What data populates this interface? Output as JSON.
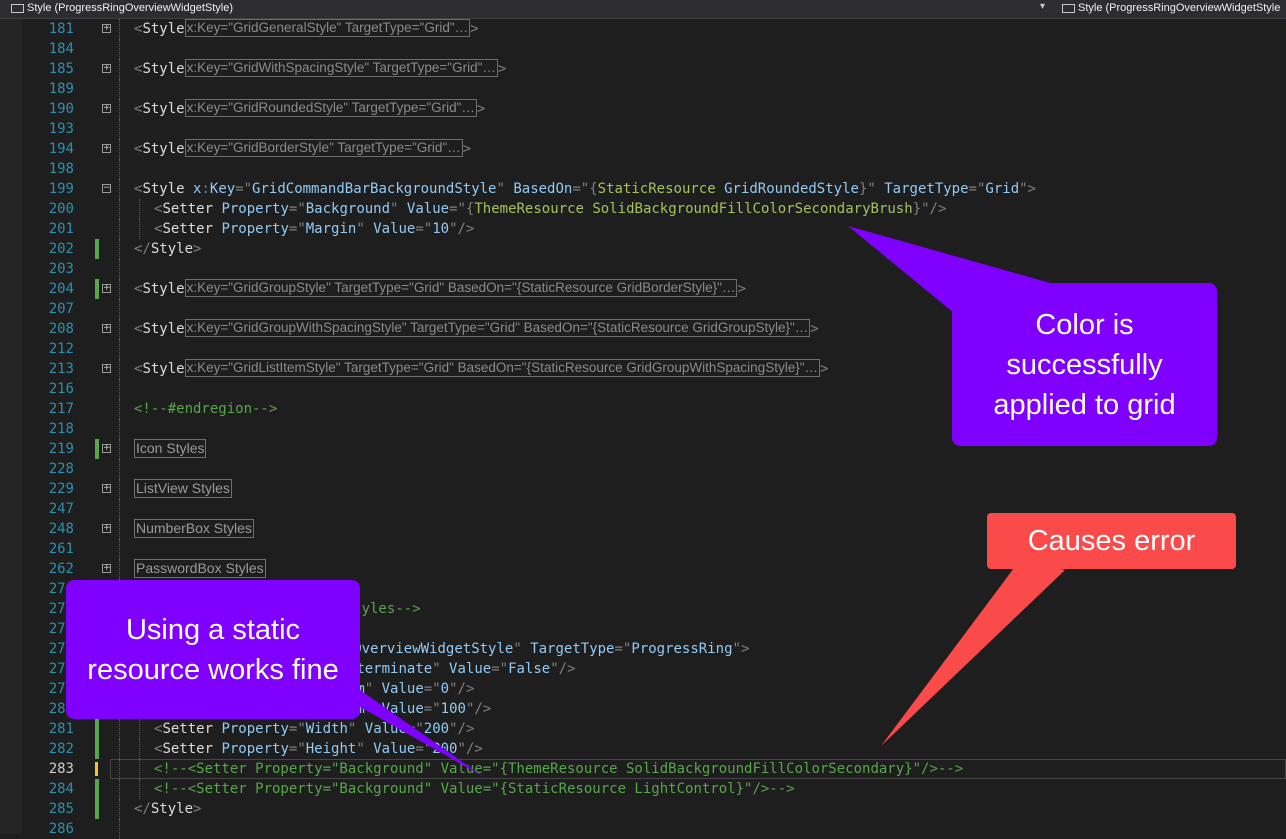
{
  "toolbar": {
    "left_label": "Style (ProgressRingOverviewWidgetStyle)",
    "right_label": "Style (ProgressRingOverviewWidgetStyle"
  },
  "lines": [
    {
      "n": "181",
      "tokens": [
        [
          "<",
          "p"
        ],
        [
          "Style",
          "e"
        ]
      ],
      "collapsed": "x:Key=\"GridGeneralStyle\" TargetType=\"Grid\"…",
      "after": ">",
      "fold": true
    },
    {
      "n": "184",
      "tokens": []
    },
    {
      "n": "185",
      "tokens": [
        [
          "<",
          "p"
        ],
        [
          "Style",
          "e"
        ]
      ],
      "collapsed": "x:Key=\"GridWithSpacingStyle\" TargetType=\"Grid\"…",
      "after": ">",
      "fold": true
    },
    {
      "n": "189",
      "tokens": []
    },
    {
      "n": "190",
      "tokens": [
        [
          "<",
          "p"
        ],
        [
          "Style",
          "e"
        ]
      ],
      "collapsed": "x:Key=\"GridRoundedStyle\" TargetType=\"Grid\"…",
      "after": ">",
      "fold": true
    },
    {
      "n": "193",
      "tokens": []
    },
    {
      "n": "194",
      "tokens": [
        [
          "<",
          "p"
        ],
        [
          "Style",
          "e"
        ]
      ],
      "collapsed": "x:Key=\"GridBorderStyle\" TargetType=\"Grid\"…",
      "after": ">",
      "fold": true
    },
    {
      "n": "198",
      "tokens": []
    },
    {
      "n": "199",
      "tokens": [
        [
          "<",
          "p"
        ],
        [
          "Style ",
          "e"
        ],
        [
          "x",
          "a"
        ],
        [
          ":",
          "p"
        ],
        [
          "Key",
          "a"
        ],
        [
          "=\"",
          "p"
        ],
        [
          "GridCommandBarBackgroundStyle",
          "a"
        ],
        [
          "\" ",
          "p"
        ],
        [
          "BasedOn",
          "a"
        ],
        [
          "=\"{",
          "p"
        ],
        [
          "StaticResource ",
          "v"
        ],
        [
          "GridRoundedStyle",
          "a"
        ],
        [
          "}\" ",
          "p"
        ],
        [
          "TargetType",
          "a"
        ],
        [
          "=\"",
          "p"
        ],
        [
          "Grid",
          "a"
        ],
        [
          "\">",
          "p"
        ]
      ],
      "fold": "minus"
    },
    {
      "n": "200",
      "indent": 1,
      "tokens": [
        [
          "<",
          "p"
        ],
        [
          "Setter ",
          "e"
        ],
        [
          "Property",
          "a"
        ],
        [
          "=\"",
          "p"
        ],
        [
          "Background",
          "a"
        ],
        [
          "\" ",
          "p"
        ],
        [
          "Value",
          "a"
        ],
        [
          "=\"{",
          "p"
        ],
        [
          "ThemeResource ",
          "v"
        ],
        [
          "SolidBackgroundFillColorSecondaryBrush",
          "v"
        ],
        [
          "}\"",
          "p"
        ],
        [
          "/>",
          "p"
        ]
      ]
    },
    {
      "n": "201",
      "indent": 1,
      "tokens": [
        [
          "<",
          "p"
        ],
        [
          "Setter ",
          "e"
        ],
        [
          "Property",
          "a"
        ],
        [
          "=\"",
          "p"
        ],
        [
          "Margin",
          "a"
        ],
        [
          "\" ",
          "p"
        ],
        [
          "Value",
          "a"
        ],
        [
          "=\"",
          "p"
        ],
        [
          "10",
          "a"
        ],
        [
          "\"",
          "p"
        ],
        [
          "/>",
          "p"
        ]
      ]
    },
    {
      "n": "202",
      "tokens": [
        [
          "</",
          "p"
        ],
        [
          "Style",
          "e"
        ],
        [
          ">",
          "p"
        ]
      ],
      "chg": true
    },
    {
      "n": "203",
      "tokens": []
    },
    {
      "n": "204",
      "tokens": [
        [
          "<",
          "p"
        ],
        [
          "Style",
          "e"
        ]
      ],
      "collapsed": "x:Key=\"GridGroupStyle\" TargetType=\"Grid\" BasedOn=\"{StaticResource GridBorderStyle}\"…",
      "after": ">",
      "fold": true,
      "chg": true
    },
    {
      "n": "207",
      "tokens": []
    },
    {
      "n": "208",
      "tokens": [
        [
          "<",
          "p"
        ],
        [
          "Style",
          "e"
        ]
      ],
      "collapsed": "x:Key=\"GridGroupWithSpacingStyle\" TargetType=\"Grid\" BasedOn=\"{StaticResource GridGroupStyle}\"…",
      "after": ">",
      "fold": true
    },
    {
      "n": "212",
      "tokens": []
    },
    {
      "n": "213",
      "tokens": [
        [
          "<",
          "p"
        ],
        [
          "Style",
          "e"
        ]
      ],
      "collapsed": "x:Key=\"GridListItemStyle\" TargetType=\"Grid\" BasedOn=\"{StaticResource GridGroupWithSpacingStyle}\"…",
      "after": ">",
      "fold": true
    },
    {
      "n": "216",
      "tokens": []
    },
    {
      "n": "217",
      "tokens": [
        [
          "<!--#endregion-->",
          "c"
        ]
      ]
    },
    {
      "n": "218",
      "tokens": []
    },
    {
      "n": "219",
      "region": "Icon Styles",
      "fold": true,
      "chg": true
    },
    {
      "n": "228",
      "tokens": []
    },
    {
      "n": "229",
      "region": "ListView Styles",
      "fold": true
    },
    {
      "n": "247",
      "tokens": []
    },
    {
      "n": "248",
      "region": "NumberBox Styles",
      "fold": true
    },
    {
      "n": "261",
      "tokens": []
    },
    {
      "n": "262",
      "region": "PasswordBox Styles",
      "fold": true
    },
    {
      "n": "274",
      "tokens": []
    },
    {
      "n": "275",
      "tokens": [
        [
          "<!--#region ProgressRing Styles-->",
          "c"
        ]
      ]
    },
    {
      "n": "276",
      "tokens": []
    },
    {
      "n": "277",
      "tokens": [
        [
          "<",
          "p"
        ],
        [
          "Style ",
          "e"
        ],
        [
          "x",
          "a"
        ],
        [
          ":",
          "p"
        ],
        [
          "Key",
          "a"
        ],
        [
          "=\"",
          "p"
        ],
        [
          "ProgressRingOverviewWidgetStyle",
          "a"
        ],
        [
          "\" ",
          "p"
        ],
        [
          "TargetType",
          "a"
        ],
        [
          "=\"",
          "p"
        ],
        [
          "ProgressRing",
          "a"
        ],
        [
          "\">",
          "p"
        ]
      ]
    },
    {
      "n": "278",
      "indent": 1,
      "tokens": [
        [
          "<",
          "p"
        ],
        [
          "Setter ",
          "e"
        ],
        [
          "Property",
          "a"
        ],
        [
          "=\"",
          "p"
        ],
        [
          "IsIndeterminate",
          "a"
        ],
        [
          "\" ",
          "p"
        ],
        [
          "Value",
          "a"
        ],
        [
          "=\"",
          "p"
        ],
        [
          "False",
          "a"
        ],
        [
          "\"",
          "p"
        ],
        [
          "/>",
          "p"
        ]
      ]
    },
    {
      "n": "279",
      "indent": 1,
      "tokens": [
        [
          "<",
          "p"
        ],
        [
          "Setter ",
          "e"
        ],
        [
          "Property",
          "a"
        ],
        [
          "=\"",
          "p"
        ],
        [
          "Minimum",
          "a"
        ],
        [
          "\" ",
          "p"
        ],
        [
          "Value",
          "a"
        ],
        [
          "=\"",
          "p"
        ],
        [
          "0",
          "a"
        ],
        [
          "\"",
          "p"
        ],
        [
          "/>",
          "p"
        ]
      ]
    },
    {
      "n": "280",
      "indent": 1,
      "tokens": [
        [
          "<",
          "p"
        ],
        [
          "Setter ",
          "e"
        ],
        [
          "Property",
          "a"
        ],
        [
          "=\"",
          "p"
        ],
        [
          "Maximum",
          "a"
        ],
        [
          "\" ",
          "p"
        ],
        [
          "Value",
          "a"
        ],
        [
          "=\"",
          "p"
        ],
        [
          "100",
          "a"
        ],
        [
          "\"",
          "p"
        ],
        [
          "/>",
          "p"
        ]
      ]
    },
    {
      "n": "281",
      "indent": 1,
      "tokens": [
        [
          "<",
          "p"
        ],
        [
          "Setter ",
          "e"
        ],
        [
          "Property",
          "a"
        ],
        [
          "=\"",
          "p"
        ],
        [
          "Width",
          "a"
        ],
        [
          "\" ",
          "p"
        ],
        [
          "Value",
          "a"
        ],
        [
          "=\"",
          "p"
        ],
        [
          "200",
          "a"
        ],
        [
          "\"",
          "p"
        ],
        [
          "/>",
          "p"
        ]
      ],
      "chg": true
    },
    {
      "n": "282",
      "indent": 1,
      "tokens": [
        [
          "<",
          "p"
        ],
        [
          "Setter ",
          "e"
        ],
        [
          "Property",
          "a"
        ],
        [
          "=\"",
          "p"
        ],
        [
          "Height",
          "a"
        ],
        [
          "\" ",
          "p"
        ],
        [
          "Value",
          "a"
        ],
        [
          "=\"",
          "p"
        ],
        [
          "200",
          "a"
        ],
        [
          "\"",
          "p"
        ],
        [
          "/>",
          "p"
        ]
      ],
      "chg": true
    },
    {
      "n": "283",
      "indent": 1,
      "tokens": [
        [
          "<!--<Setter Property=\"Background\" Value=\"{ThemeResource SolidBackgroundFillColorSecondary}\"/>-->",
          "c"
        ]
      ],
      "current": true,
      "chg": "y"
    },
    {
      "n": "284",
      "indent": 1,
      "tokens": [
        [
          "<!--<Setter Property=\"Background\" Value=\"{StaticResource LightControl}\"/>-->",
          "c"
        ]
      ],
      "chg": true
    },
    {
      "n": "285",
      "tokens": [
        [
          "</",
          "p"
        ],
        [
          "Style",
          "e"
        ],
        [
          ">",
          "p"
        ]
      ],
      "chg": true
    },
    {
      "n": "286",
      "tokens": []
    }
  ],
  "callouts": {
    "color_applied": "Color is successfully applied to grid",
    "causes_error": "Causes error",
    "static_resource": "Using a static resource works fine"
  },
  "colors": {
    "callout_purple": "#8000ff",
    "callout_red": "#fb4a4a",
    "editor_bg": "#1e1e1e",
    "line_number": "#2b91af",
    "comment": "#57a64a",
    "element": "#dcdcdc",
    "attribute": "#92caf4",
    "markup_extension": "#a5c25c"
  }
}
